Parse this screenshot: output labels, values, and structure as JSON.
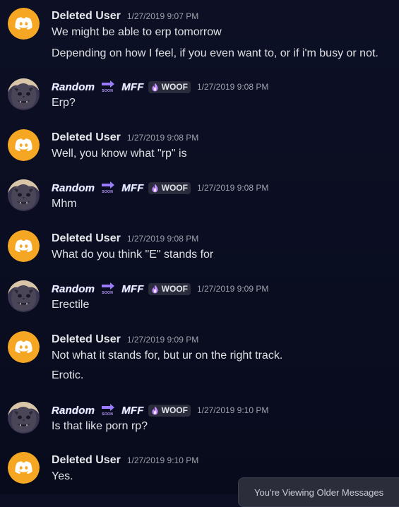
{
  "colors": {
    "discord_avatar": "#f5a623",
    "background": "#0b0e22",
    "tag_bg": "#2a2c3c",
    "timestamp": "#9ea1ab"
  },
  "users": {
    "deleted": {
      "name": "Deleted User",
      "avatar_icon": "discord-logo-icon"
    },
    "random": {
      "name_part1": "Random",
      "arrow_emoji": "soon-arrow-icon",
      "arrow_caption": "SOON",
      "name_part2": "MFF",
      "tag_icon": "flame-icon",
      "tag": "WOOF",
      "avatar_icon": "gargoyle-avatar-icon"
    }
  },
  "messages": [
    {
      "author": "deleted",
      "time": "1/27/2019 9:07 PM",
      "lines": [
        "We might be able to erp tomorrow",
        "Depending on how I feel, if you even want to, or if i'm busy or not."
      ]
    },
    {
      "author": "random",
      "time": "1/27/2019 9:08 PM",
      "lines": [
        "Erp?"
      ]
    },
    {
      "author": "deleted",
      "time": "1/27/2019 9:08 PM",
      "lines": [
        "Well, you know what \"rp\" is"
      ]
    },
    {
      "author": "random",
      "time": "1/27/2019 9:08 PM",
      "lines": [
        "Mhm"
      ]
    },
    {
      "author": "deleted",
      "time": "1/27/2019 9:08 PM",
      "lines": [
        "What do you think \"E\" stands for"
      ]
    },
    {
      "author": "random",
      "time": "1/27/2019 9:09 PM",
      "lines": [
        "Erectile"
      ]
    },
    {
      "author": "deleted",
      "time": "1/27/2019 9:09 PM",
      "lines": [
        "Not what it stands for, but ur on the right track.",
        "Erotic."
      ]
    },
    {
      "author": "random",
      "time": "1/27/2019 9:10 PM",
      "lines": [
        "Is that like porn rp?"
      ]
    },
    {
      "author": "deleted",
      "time": "1/27/2019 9:10 PM",
      "lines": [
        "Yes."
      ]
    }
  ],
  "toast": {
    "text": "You're Viewing Older Messages"
  }
}
